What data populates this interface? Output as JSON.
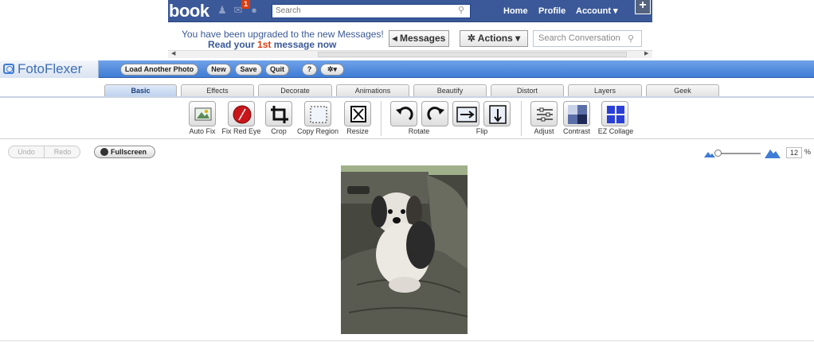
{
  "facebook": {
    "logo": "book",
    "notification_count": "1",
    "search_placeholder": "Search",
    "nav": {
      "home": "Home",
      "profile": "Profile",
      "account": "Account ▾"
    },
    "brand_color": "#3b5998"
  },
  "messages_notice": {
    "line1": "You have been upgraded to the new Messages!",
    "line2_prefix": "Read your ",
    "line2_highlight": "1st",
    "line2_suffix": " message now",
    "messages_button": "◂ Messages",
    "actions_button": "✲ Actions ▾",
    "search_placeholder": "Search Conversation"
  },
  "fotoflexer": {
    "logo": "FotoFlexer",
    "header_buttons": {
      "load": "Load Another Photo",
      "new": "New",
      "save": "Save",
      "quit": "Quit",
      "help": "?",
      "settings": "✲▾"
    },
    "tabs": [
      "Basic",
      "Effects",
      "Decorate",
      "Animations",
      "Beautify",
      "Distort",
      "Layers",
      "Geek"
    ],
    "active_tab": "Basic",
    "tools": {
      "auto_fix": "Auto Fix",
      "fix_red_eye": "Fix Red Eye",
      "crop": "Crop",
      "copy_region": "Copy Region",
      "resize": "Resize",
      "rotate": "Rotate",
      "flip": "Flip",
      "adjust": "Adjust",
      "contrast": "Contrast",
      "ez_collage": "EZ Collage"
    },
    "undo": "Undo",
    "redo": "Redo",
    "fullscreen": "Fullscreen",
    "zoom_value": "12",
    "zoom_unit": "%",
    "accent_color": "#3f7cd6"
  }
}
